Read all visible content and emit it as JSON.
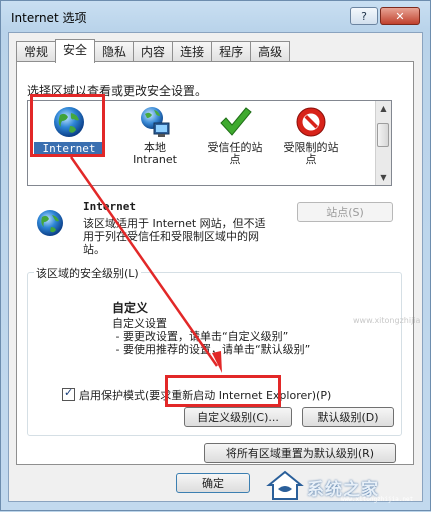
{
  "window": {
    "title": "Internet 选项",
    "help_label": "?",
    "close_label": "✕"
  },
  "tabs": [
    {
      "label": "常规"
    },
    {
      "label": "安全"
    },
    {
      "label": "隐私"
    },
    {
      "label": "内容"
    },
    {
      "label": "连接"
    },
    {
      "label": "程序"
    },
    {
      "label": "高级"
    }
  ],
  "active_tab": "安全",
  "security": {
    "zone_prompt": "选择区域以查看或更改安全设置。",
    "zones": [
      {
        "line1": "Internet",
        "line2": "",
        "icon": "globe-icon",
        "selected": true
      },
      {
        "line1": "本地",
        "line2": "Intranet",
        "icon": "local-intranet-icon",
        "selected": false
      },
      {
        "line1": "受信任的站",
        "line2": "点",
        "icon": "trusted-sites-check-icon",
        "selected": false
      },
      {
        "line1": "受限制的站",
        "line2": "点",
        "icon": "restricted-sites-icon",
        "selected": false
      }
    ],
    "selected_zone": {
      "name": "Internet",
      "description": "该区域适用于 Internet 网站，但不适用于列在受信任和受限制区域中的网站。",
      "sites_button": "站点(S)"
    },
    "level_group_title": "该区域的安全级别(L)",
    "level": {
      "name": "自定义",
      "description": "自定义设置\n - 要更改设置，请单击“自定义级别”\n - 要使用推荐的设置，请单击“默认级别”"
    },
    "protected_mode_label": "启用保护模式(要求重新启动 Internet Explorer)(P)",
    "protected_mode_checked": true,
    "custom_level_button": "自定义级别(C)...",
    "default_level_button": "默认级别(D)",
    "reset_all_button": "将所有区域重置为默认级别(R)"
  },
  "footer": {
    "ok_button": "确定"
  },
  "watermark": {
    "text": "系统之家",
    "sub": "www.xitongzhijia.net"
  },
  "ghost_url": "www.xitongzhijia",
  "colors": {
    "highlight": "#e22828",
    "selection": "#3a6fb0",
    "titlebar": "#c9dff2"
  }
}
